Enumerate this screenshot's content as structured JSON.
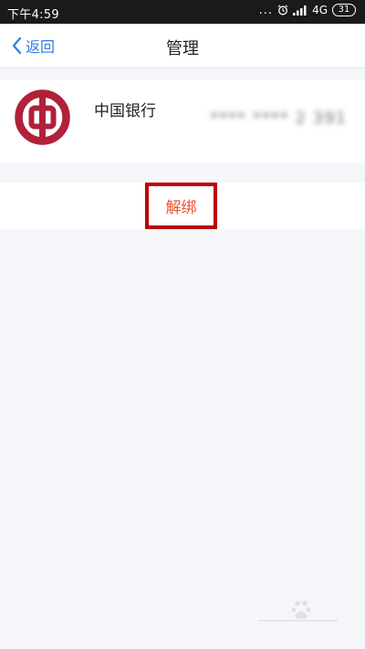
{
  "status_bar": {
    "time": "下午4:59",
    "dots": "...",
    "network": "4G",
    "battery": "31"
  },
  "nav": {
    "back_label": "返回",
    "title": "管理"
  },
  "card": {
    "bank_name": "中国银行",
    "card_number_masked": "**** **** 2 391"
  },
  "actions": {
    "unbind_label": "解绑"
  },
  "colors": {
    "accent": "#2f7de1",
    "unbind_text": "#f0512f",
    "highlight_box": "#bb0000",
    "bank_logo_red": "#b0213a",
    "page_bg": "#f5f6fa"
  },
  "icons": {
    "back": "chevron-left-icon",
    "alarm": "alarm-clock-icon",
    "signal": "signal-bars-icon",
    "battery": "battery-icon",
    "bank_logo": "bank-of-china-logo"
  }
}
